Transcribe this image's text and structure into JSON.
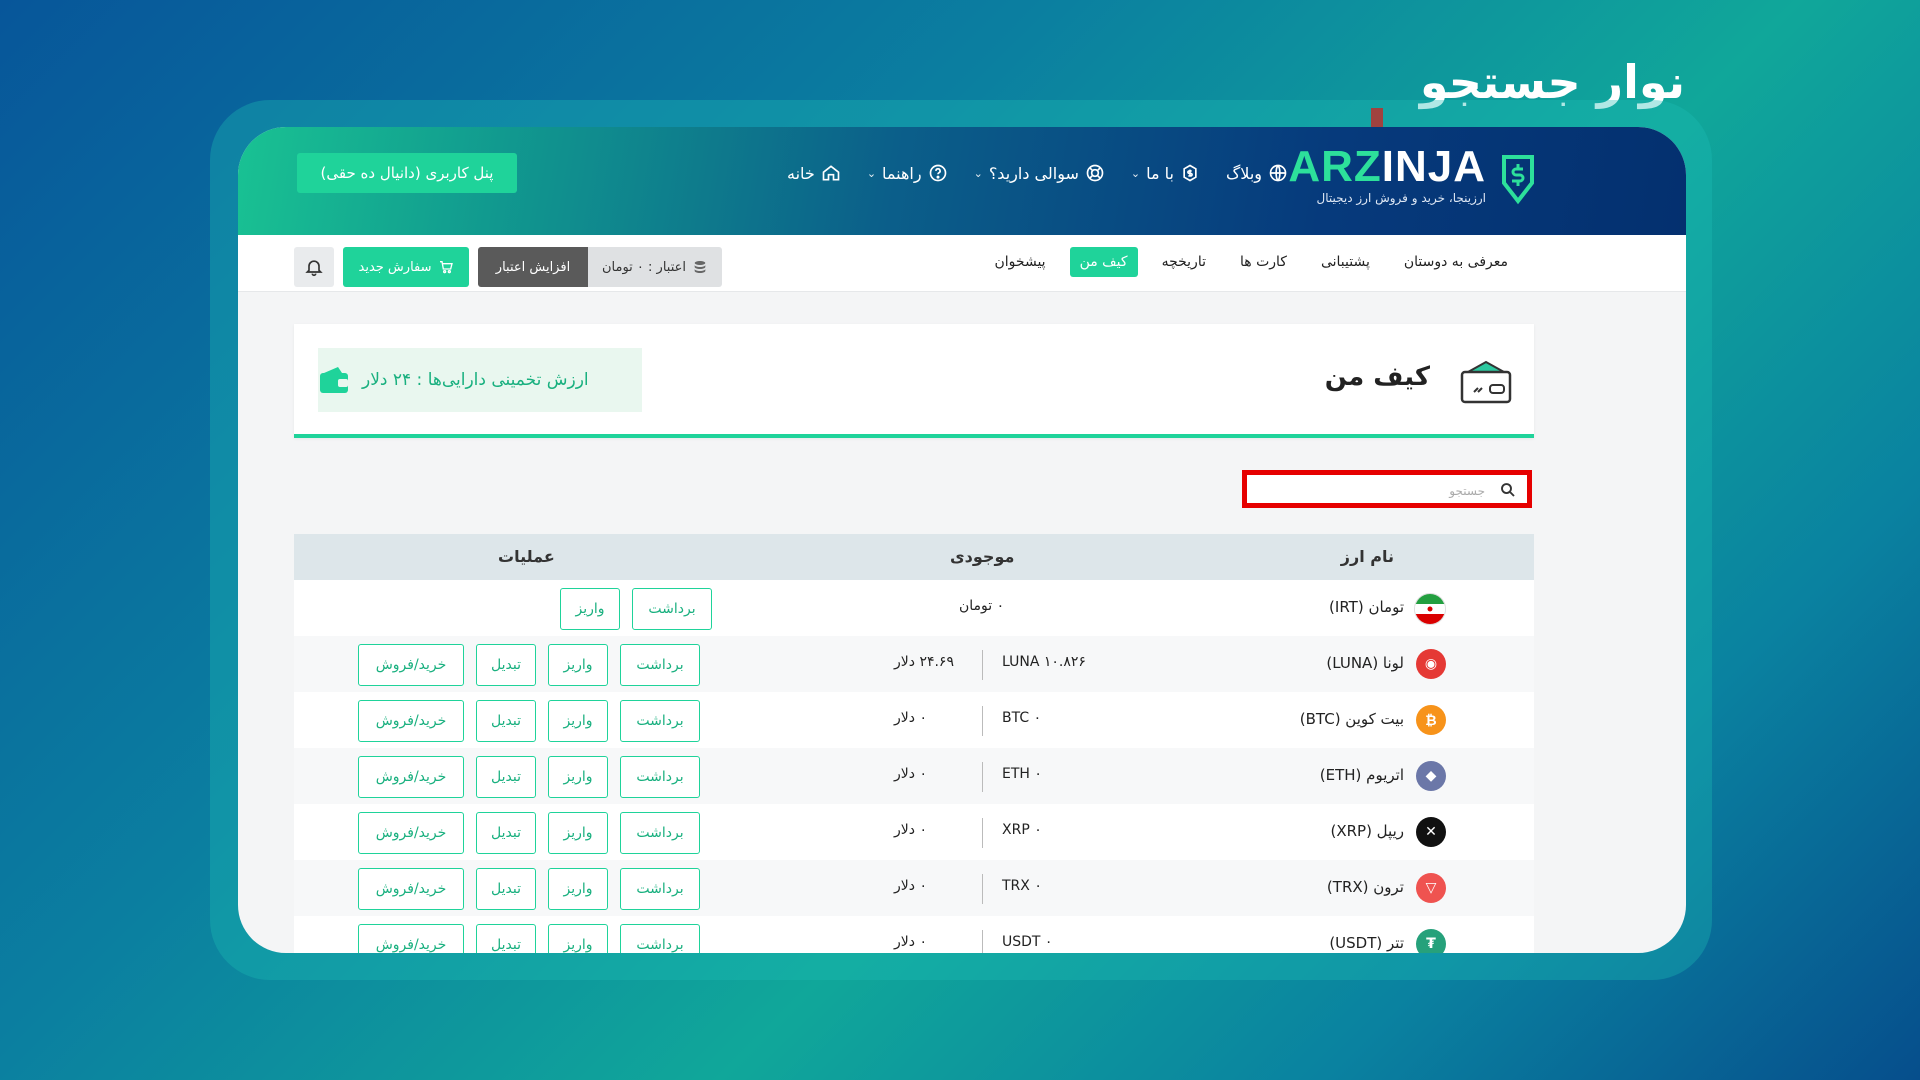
{
  "overlay_title": "نوار جستجو",
  "header": {
    "brand_text": "ARZINJA",
    "brand_prefix": "ARZ",
    "brand_suffix": "INJA",
    "brand_tagline": "ارزینجا، خرید و فروش ارز دیجیتال",
    "user_panel_label": "پنل کاربری (دانیال ده حقی)",
    "nav": [
      {
        "label": "خانه",
        "icon": "home-icon"
      },
      {
        "label": "راهنما",
        "icon": "help-icon",
        "has_dropdown": true
      },
      {
        "label": "سوالی دارید؟",
        "icon": "support-icon",
        "has_dropdown": true
      },
      {
        "label": "با ما",
        "icon": "dollar-icon",
        "has_dropdown": true
      },
      {
        "label": "وبلاگ",
        "icon": "globe-icon"
      }
    ]
  },
  "subnav": {
    "tabs": [
      "پیشخوان",
      "کیف من",
      "تاریخچه",
      "کارت ها",
      "پشتیبانی",
      "معرفی به دوستان"
    ],
    "active_tab": "کیف من",
    "credit_label": "اعتبار : ۰ تومان",
    "increase_credit": "افزایش اعتبار",
    "new_order": "سفارش جدید"
  },
  "wallet": {
    "title": "کیف من",
    "asset_value": "ارزش تخمینی دارایی‌ها :  ۲۴ دلار"
  },
  "search": {
    "placeholder": "جستجو",
    "value": ""
  },
  "table": {
    "headers": {
      "currency": "نام ارز",
      "balance": "موجودی",
      "operations": "عملیات"
    },
    "actions": {
      "withdraw": "برداشت",
      "deposit": "واریز",
      "convert": "تبدیل",
      "trade": "خرید/فروش"
    },
    "rows": [
      {
        "name": "تومان (IRT)",
        "balance": "۰ تومان",
        "icon": "iran-flag-icon",
        "color": "#ffffff"
      },
      {
        "name": "لونا (LUNA)",
        "amount": "۱۰.۸۲۶  LUNA",
        "usd": "۲۴.۶۹  دلار",
        "icon": "luna-icon",
        "color": "#e53935"
      },
      {
        "name": "بیت کوین (BTC)",
        "amount": "۰  BTC",
        "usd": "۰  دلار",
        "icon": "btc-icon",
        "color": "#f7931a"
      },
      {
        "name": "اتریوم (ETH)",
        "amount": "۰  ETH",
        "usd": "۰  دلار",
        "icon": "eth-icon",
        "color": "#6b77a8"
      },
      {
        "name": "ریپل (XRP)",
        "amount": "۰  XRP",
        "usd": "۰  دلار",
        "icon": "xrp-icon",
        "color": "#111111"
      },
      {
        "name": "ترون (TRX)",
        "amount": "۰  TRX",
        "usd": "۰  دلار",
        "icon": "trx-icon",
        "color": "#ef5350"
      },
      {
        "name": "تتر (USDT)",
        "amount": "۰  USDT",
        "usd": "۰  دلار",
        "icon": "usdt-icon",
        "color": "#26a17b"
      }
    ]
  },
  "colors": {
    "accent": "#1fd39a",
    "highlight": "#e60000",
    "header_dark": "#04306f"
  }
}
